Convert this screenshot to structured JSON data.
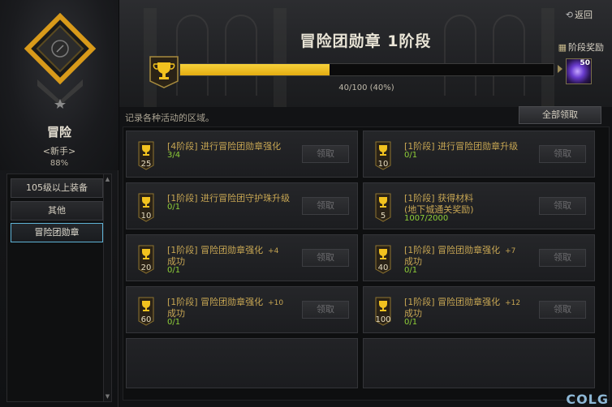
{
  "left": {
    "rank_title": "冒险",
    "rank_sub": "<新手>",
    "rank_pct": "88%",
    "items": [
      {
        "label": "105级以上装备"
      },
      {
        "label": "其他"
      },
      {
        "label": "冒险团勋章"
      }
    ]
  },
  "header": {
    "return_label": "返回",
    "title": "冒险团勋章 1阶段",
    "stage_reward_label": "阶段奖励",
    "progress_text": "40/100 (40%)",
    "progress_fraction": 0.4,
    "reward_count": "50"
  },
  "desc": "记录各种活动的区域。",
  "claim_all_label": "全部领取",
  "quests": [
    {
      "stage": "[4阶段]",
      "title": "进行冒险团勋章强化",
      "progress": "3/4",
      "badge": "25",
      "button": "领取"
    },
    {
      "stage": "[1阶段]",
      "title": "进行冒险团勋章升级",
      "progress": "0/1",
      "badge": "10",
      "button": "领取"
    },
    {
      "stage": "[1阶段]",
      "title": "进行冒险团守护珠升级",
      "progress": "0/1",
      "badge": "10",
      "button": "领取"
    },
    {
      "stage": "[1阶段]",
      "title": "获得材料",
      "line2": "(地下城通关奖励)",
      "progress": "1007/2000",
      "badge": "5",
      "button": "领取"
    },
    {
      "stage": "[1阶段]",
      "title": "冒险团勋章强化",
      "plus": "+4",
      "line2": "成功",
      "progress": "0/1",
      "badge": "20",
      "button": "领取"
    },
    {
      "stage": "[1阶段]",
      "title": "冒险团勋章强化",
      "plus": "+7",
      "line2": "成功",
      "progress": "0/1",
      "badge": "40",
      "button": "领取"
    },
    {
      "stage": "[1阶段]",
      "title": "冒险团勋章强化",
      "plus": "+10",
      "line2": "成功",
      "progress": "0/1",
      "badge": "60",
      "button": "领取"
    },
    {
      "stage": "[1阶段]",
      "title": "冒险团勋章强化",
      "plus": "+12",
      "line2": "成功",
      "progress": "0/1",
      "badge": "100",
      "button": "领取"
    }
  ],
  "watermark": "COLG",
  "colors": {
    "gold": "#c7a653",
    "progress": "#8fcf38",
    "bar": "#f2c21f",
    "active_border": "#5fb3d6"
  }
}
